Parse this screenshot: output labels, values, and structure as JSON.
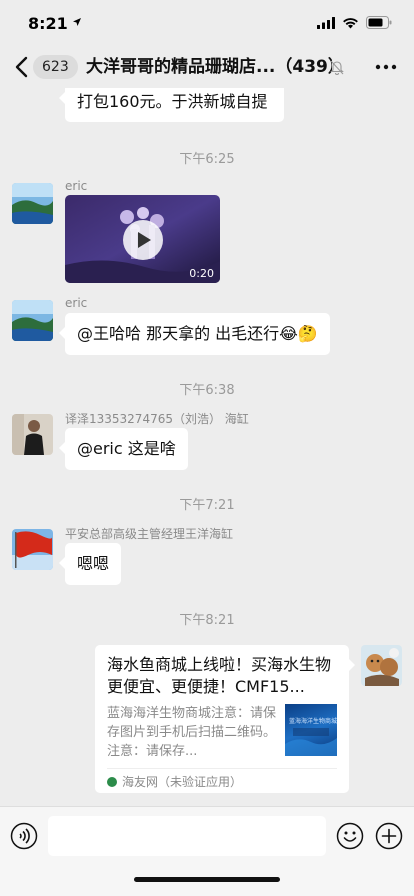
{
  "status_bar": {
    "time": "8:21"
  },
  "nav": {
    "unread_badge": "623",
    "title": "大洋哥哥的精品珊瑚店...（439）"
  },
  "messages": {
    "top_partial_text": "打包160元。于洪新城自提",
    "time_1": "下午6:25",
    "msg1": {
      "sender": "eric",
      "video_duration": "0:20"
    },
    "msg2": {
      "sender": "eric",
      "text": "@王哈哈 那天拿的 出毛还行😂🤔"
    },
    "time_2": "下午6:38",
    "msg3": {
      "sender": "译泽13353274765（刘浩） 海缸",
      "text": "@eric 这是啥"
    },
    "time_3": "下午7:21",
    "msg4": {
      "sender": "平安总部高级主管经理王洋海缸",
      "text": "嗯嗯"
    },
    "time_4": "下午8:21",
    "card": {
      "title": "海水鱼商城上线啦！买海水生物更便宜、更便捷！CMF15...",
      "desc": "蓝海海洋生物商城注意：请保存图片到手机后扫描二维码。注意：请保存...",
      "thumb_text": "蓝海海洋生物商城",
      "source": "海友网（未验证应用）"
    }
  },
  "colors": {
    "background": "#ededed",
    "bubble": "#ffffff",
    "muted_text": "#9a9a9a"
  }
}
